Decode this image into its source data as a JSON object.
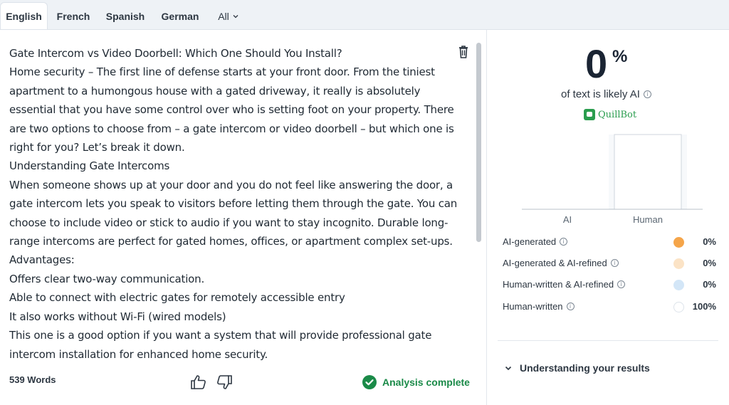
{
  "tabs": [
    {
      "label": "English"
    },
    {
      "label": "French"
    },
    {
      "label": "Spanish"
    },
    {
      "label": "German"
    },
    {
      "label": "All"
    }
  ],
  "document": {
    "paragraphs": [
      "Gate Intercom vs Video Doorbell: Which One Should You Install?",
      "Home security – The first line of defense starts at your front door. From the tiniest apartment to a humongous house with a gated driveway, it really is absolutely essential that you have some control over who is setting foot on your property. There are two options to choose from – a gate intercom or video doorbell – but which one is right for you? Let’s break it down.",
      "Understanding Gate Intercoms",
      "When someone shows up at your door and you do not feel like answering the door, a gate intercom lets you speak to visitors before letting them through the gate. You can choose to include video or stick to audio if you want to stay incognito. Durable long-range intercoms are perfect for gated homes, offices, or apartment complex set-ups.",
      "Advantages:",
      "Offers clear two-way communication.",
      "Able to connect with electric gates for remotely accessible entry",
      "It also works without Wi-Fi (wired models)",
      "This one is a good option if you want a system that will provide professional gate intercom installation for enhanced home security."
    ]
  },
  "footer": {
    "word_count": "539 Words",
    "status": "Analysis complete"
  },
  "results": {
    "score": "0",
    "score_unit": "%",
    "likely_text": "of text is likely AI",
    "brand": "QuillBot",
    "chart_data": {
      "type": "bar",
      "categories": [
        "AI",
        "Human"
      ],
      "values": [
        0,
        100
      ],
      "ylim": [
        0,
        100
      ]
    },
    "legend": [
      {
        "label": "AI-generated",
        "value": "0%",
        "color": "#f5a54a"
      },
      {
        "label": "AI-generated & AI-refined",
        "value": "0%",
        "color": "#fbe3c6"
      },
      {
        "label": "Human-written & AI-refined",
        "value": "0%",
        "color": "#d3e6f7"
      },
      {
        "label": "Human-written",
        "value": "100%",
        "color": "#ffffff"
      }
    ],
    "understanding": "Understanding your results"
  }
}
